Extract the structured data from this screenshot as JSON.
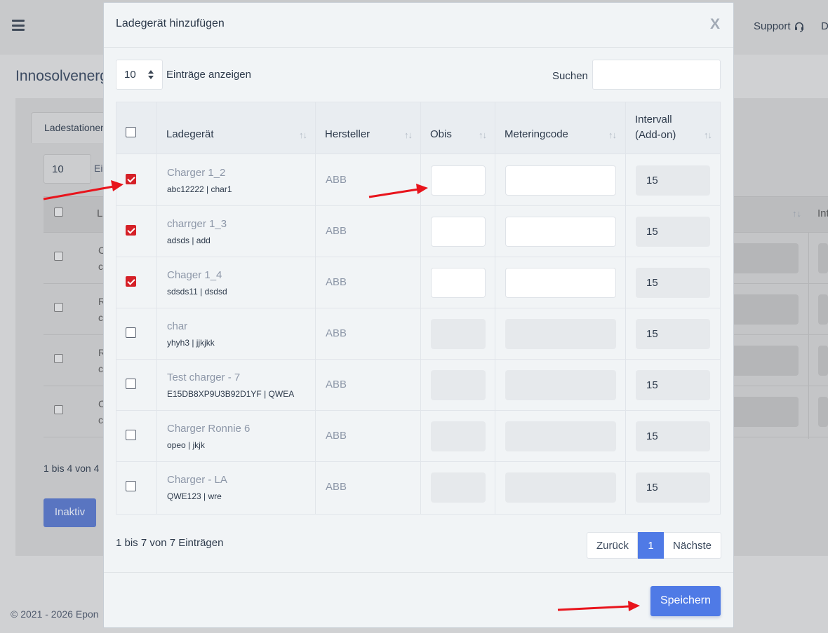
{
  "background": {
    "top_fragment": "i",
    "support_label": "Support",
    "top_fragment_right": "D",
    "page_title": "Innosolvenergy",
    "tab_label": "Ladestationen",
    "length_value": "10",
    "length_fragment": "Ei",
    "col_fragment": "L",
    "col_fragment_right": "Int",
    "sort_glyph": "↑↓",
    "row_fragments": [
      {
        "a": "C",
        "b": "c"
      },
      {
        "a": "R",
        "b": "c"
      },
      {
        "a": "R",
        "b": "c"
      },
      {
        "a": "C",
        "b": "c"
      }
    ],
    "info_text": "1 bis 4 von 4",
    "inaktiv_label": "Inaktiv",
    "footer_text": "© 2021 - 2026 Epon"
  },
  "modal": {
    "title": "Ladegerät hinzufügen",
    "close_label": "X",
    "length_value": "10",
    "length_label": "Einträge anzeigen",
    "search_label": "Suchen",
    "search_value": "",
    "columns": {
      "charger": "Ladegerät",
      "manufacturer": "Hersteller",
      "obis": "Obis",
      "meteringcode": "Meteringcode",
      "interval_line1": "Intervall",
      "interval_line2": "(Add-on)",
      "sort_glyph": "↑↓"
    },
    "rows": [
      {
        "name": "Charger 1_2",
        "sub": "abc12222 | char1",
        "manufacturer": "ABB",
        "interval": "15",
        "checked": true
      },
      {
        "name": "charrger 1_3",
        "sub": "adsds | add",
        "manufacturer": "ABB",
        "interval": "15",
        "checked": true
      },
      {
        "name": "Chager 1_4",
        "sub": "sdsds11 | dsdsd",
        "manufacturer": "ABB",
        "interval": "15",
        "checked": true
      },
      {
        "name": "char",
        "sub": "yhyh3 | jjkjkk",
        "manufacturer": "ABB",
        "interval": "15",
        "checked": false
      },
      {
        "name": "Test charger - 7",
        "sub": "E15DB8XP9U3B92D1YF | QWEA",
        "manufacturer": "ABB",
        "interval": "15",
        "checked": false
      },
      {
        "name": "Charger Ronnie 6",
        "sub": "opeo | jkjk",
        "manufacturer": "ABB",
        "interval": "15",
        "checked": false
      },
      {
        "name": "Charger - LA",
        "sub": "QWE123 | wre",
        "manufacturer": "ABB",
        "interval": "15",
        "checked": false
      }
    ],
    "info_text": "1 bis 7 von 7 Einträgen",
    "pager": {
      "prev": "Zurück",
      "current": "1",
      "next": "Nächste"
    },
    "save_label": "Speichern"
  },
  "colors": {
    "accent": "#4f7ae6",
    "checkbox_checked": "#d52027",
    "annotation_arrow": "#e8141c"
  }
}
